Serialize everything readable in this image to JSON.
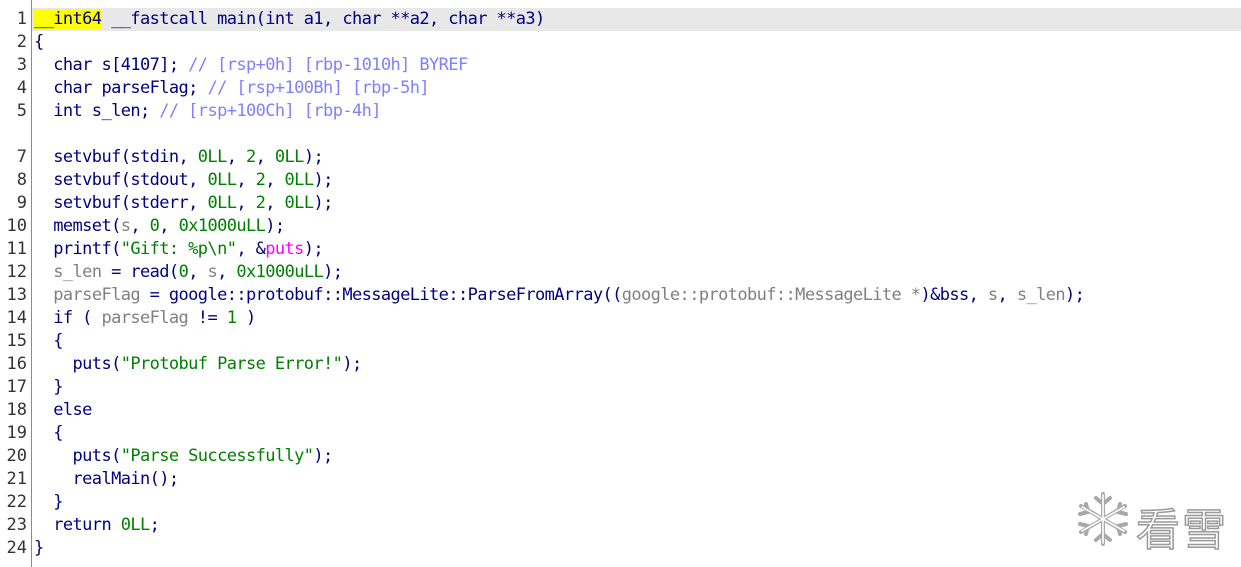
{
  "lines": [
    {
      "num": "1",
      "tokens": [
        [
          "t-kw t-hl",
          "__int64"
        ],
        [
          "t-pl",
          " __fastcall main(int a1, char **a2, char **a3)"
        ]
      ]
    },
    {
      "num": "2",
      "tokens": [
        [
          "t-pl",
          "{"
        ]
      ]
    },
    {
      "num": "3",
      "tokens": [
        [
          "t-pl",
          "  char s[4107]; "
        ],
        [
          "t-cmt",
          "// [rsp+0h] [rbp-1010h] BYREF"
        ]
      ]
    },
    {
      "num": "4",
      "tokens": [
        [
          "t-pl",
          "  char parseFlag; "
        ],
        [
          "t-cmt",
          "// [rsp+100Bh] [rbp-5h]"
        ]
      ]
    },
    {
      "num": "5",
      "tokens": [
        [
          "t-pl",
          "  int s_len; "
        ],
        [
          "t-cmt",
          "// [rsp+100Ch] [rbp-4h]"
        ]
      ]
    },
    {
      "num": "",
      "tokens": []
    },
    {
      "num": "7",
      "tokens": [
        [
          "t-pl",
          "  setvbuf(stdin, "
        ],
        [
          "t-num",
          "0LL"
        ],
        [
          "t-pl",
          ", "
        ],
        [
          "t-num",
          "2"
        ],
        [
          "t-pl",
          ", "
        ],
        [
          "t-num",
          "0LL"
        ],
        [
          "t-pl",
          ");"
        ]
      ]
    },
    {
      "num": "8",
      "tokens": [
        [
          "t-pl",
          "  setvbuf(stdout, "
        ],
        [
          "t-num",
          "0LL"
        ],
        [
          "t-pl",
          ", "
        ],
        [
          "t-num",
          "2"
        ],
        [
          "t-pl",
          ", "
        ],
        [
          "t-num",
          "0LL"
        ],
        [
          "t-pl",
          ");"
        ]
      ]
    },
    {
      "num": "9",
      "tokens": [
        [
          "t-pl",
          "  setvbuf(stderr, "
        ],
        [
          "t-num",
          "0LL"
        ],
        [
          "t-pl",
          ", "
        ],
        [
          "t-num",
          "2"
        ],
        [
          "t-pl",
          ", "
        ],
        [
          "t-num",
          "0LL"
        ],
        [
          "t-pl",
          ");"
        ]
      ]
    },
    {
      "num": "10",
      "tokens": [
        [
          "t-pl",
          "  memset("
        ],
        [
          "t-var",
          "s"
        ],
        [
          "t-pl",
          ", "
        ],
        [
          "t-num",
          "0"
        ],
        [
          "t-pl",
          ", "
        ],
        [
          "t-num",
          "0x1000uLL"
        ],
        [
          "t-pl",
          ");"
        ]
      ]
    },
    {
      "num": "11",
      "tokens": [
        [
          "t-pl",
          "  printf("
        ],
        [
          "t-str",
          "\"Gift: %p\\n\""
        ],
        [
          "t-pl",
          ", &"
        ],
        [
          "t-imp",
          "puts"
        ],
        [
          "t-pl",
          ");"
        ]
      ]
    },
    {
      "num": "12",
      "tokens": [
        [
          "t-pl",
          "  "
        ],
        [
          "t-var",
          "s_len"
        ],
        [
          "t-pl",
          " = read("
        ],
        [
          "t-num",
          "0"
        ],
        [
          "t-pl",
          ", "
        ],
        [
          "t-var",
          "s"
        ],
        [
          "t-pl",
          ", "
        ],
        [
          "t-num",
          "0x1000uLL"
        ],
        [
          "t-pl",
          ");"
        ]
      ]
    },
    {
      "num": "13",
      "tokens": [
        [
          "t-pl",
          "  "
        ],
        [
          "t-var",
          "parseFlag"
        ],
        [
          "t-pl",
          " = google::protobuf::MessageLite::ParseFromArray(("
        ],
        [
          "t-var",
          "google::protobuf::MessageLite *"
        ],
        [
          "t-pl",
          ")&bss, "
        ],
        [
          "t-var",
          "s"
        ],
        [
          "t-pl",
          ", "
        ],
        [
          "t-var",
          "s_len"
        ],
        [
          "t-pl",
          ");"
        ]
      ]
    },
    {
      "num": "14",
      "tokens": [
        [
          "t-pl",
          "  if ( "
        ],
        [
          "t-var",
          "parseFlag"
        ],
        [
          "t-pl",
          " != "
        ],
        [
          "t-num",
          "1"
        ],
        [
          "t-pl",
          " )"
        ]
      ]
    },
    {
      "num": "15",
      "tokens": [
        [
          "t-pl",
          "  {"
        ]
      ]
    },
    {
      "num": "16",
      "tokens": [
        [
          "t-pl",
          "    puts("
        ],
        [
          "t-str",
          "\"Protobuf Parse Error!\""
        ],
        [
          "t-pl",
          ");"
        ]
      ]
    },
    {
      "num": "17",
      "tokens": [
        [
          "t-pl",
          "  }"
        ]
      ]
    },
    {
      "num": "18",
      "tokens": [
        [
          "t-pl",
          "  else"
        ]
      ]
    },
    {
      "num": "19",
      "tokens": [
        [
          "t-pl",
          "  {"
        ]
      ]
    },
    {
      "num": "20",
      "tokens": [
        [
          "t-pl",
          "    puts("
        ],
        [
          "t-str",
          "\"Parse Successfully\""
        ],
        [
          "t-pl",
          ");"
        ]
      ]
    },
    {
      "num": "21",
      "tokens": [
        [
          "t-pl",
          "    realMain();"
        ]
      ]
    },
    {
      "num": "22",
      "tokens": [
        [
          "t-pl",
          "  }"
        ]
      ]
    },
    {
      "num": "23",
      "tokens": [
        [
          "t-pl",
          "  return "
        ],
        [
          "t-num",
          "0LL"
        ],
        [
          "t-pl",
          ";"
        ]
      ]
    },
    {
      "num": "24",
      "tokens": [
        [
          "t-pl",
          "}"
        ]
      ]
    }
  ],
  "watermark": {
    "text": "看雪",
    "icon": "snowflake-icon"
  },
  "colors": {
    "keyword_highlight": "#ffff00",
    "current_line": "#e8e8e8",
    "comment": "#8080ff",
    "number": "#008000",
    "variable": "#808080",
    "import": "#ff00ff",
    "plain": "#000080"
  }
}
